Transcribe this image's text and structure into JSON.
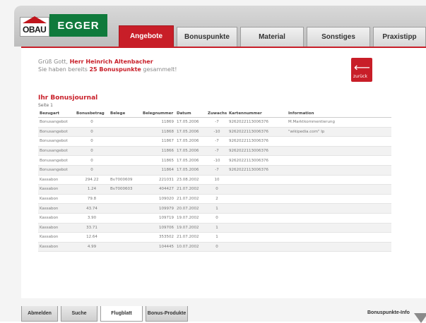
{
  "brand": {
    "obau": "OBAU",
    "egger": "EGGER"
  },
  "tabs": [
    {
      "label": "Angebote",
      "active": true
    },
    {
      "label": "Bonuspunkte",
      "active": false
    },
    {
      "label": "Material",
      "active": false
    },
    {
      "label": "Sonstiges",
      "active": false
    },
    {
      "label": "Praxistipp",
      "active": false
    }
  ],
  "greeting": {
    "line1_prefix": "Grüß Gott, ",
    "name": "Herr Heinrich Altenbacher",
    "line2_prefix": "Sie haben bereits ",
    "points": "25 Bonuspunkte",
    "line2_suffix": " gesammelt!"
  },
  "back_button": {
    "label": "zurück"
  },
  "journal": {
    "title": "Ihr Bonusjournal",
    "subtitle": "Seite 1",
    "columns": [
      "Bezugart",
      "Bonusbetrag",
      "Belege",
      "Belegnummer",
      "Datum",
      "Zuwachs",
      "Kartennummer",
      "Information"
    ],
    "rows": [
      [
        "Bonusangebot",
        "0",
        "",
        "11869",
        "17.05.2006",
        "-7",
        "9262022113006376",
        "M.Marktkommentierung"
      ],
      [
        "Bonusangebot",
        "0",
        "",
        "11868",
        "17.05.2006",
        "-10",
        "9262022113006376",
        "\"wikipedia.com\" Ip"
      ],
      [
        "Bonusangebot",
        "0",
        "",
        "11867",
        "17.05.2006",
        "-7",
        "9262022113006376",
        ""
      ],
      [
        "Bonusangebot",
        "0",
        "",
        "11866",
        "17.05.2006",
        "-7",
        "9262022113006376",
        ""
      ],
      [
        "Bonusangebot",
        "0",
        "",
        "11865",
        "17.05.2006",
        "-10",
        "9262022113006376",
        ""
      ],
      [
        "Bonusangebot",
        "0",
        "",
        "11864",
        "17.05.2006",
        "-7",
        "9262022113006376",
        ""
      ],
      [
        "Kassabon",
        "294.22",
        "Bv7000609",
        "221031",
        "23.08.2002",
        "10",
        "",
        ""
      ],
      [
        "Kassabon",
        "1.24",
        "Bv7000603",
        "404427",
        "21.07.2002",
        "0",
        "",
        ""
      ],
      [
        "Kassabon",
        "79.8",
        "",
        "109020",
        "21.07.2002",
        "2",
        "",
        ""
      ],
      [
        "Kassabon",
        "43.74",
        "",
        "109979",
        "20.07.2002",
        "1",
        "",
        ""
      ],
      [
        "Kassabon",
        "3.90",
        "",
        "109719",
        "19.07.2002",
        "0",
        "",
        ""
      ],
      [
        "Kassabon",
        "33.71",
        "",
        "109706",
        "19.07.2002",
        "1",
        "",
        ""
      ],
      [
        "Kassabon",
        "12.64",
        "",
        "353502",
        "21.07.2002",
        "1",
        "",
        ""
      ],
      [
        "Kassabon",
        "4.99",
        "",
        "104445",
        "10.07.2002",
        "0",
        "",
        ""
      ]
    ]
  },
  "bottom_tabs": [
    {
      "label": "Abmelden",
      "active": false
    },
    {
      "label": "Suche",
      "active": false
    },
    {
      "label": "Flugblatt",
      "active": true
    },
    {
      "label": "Bonus-Produkte",
      "active": false
    }
  ],
  "bonus_info_label": "Bonuspunkte-Info"
}
